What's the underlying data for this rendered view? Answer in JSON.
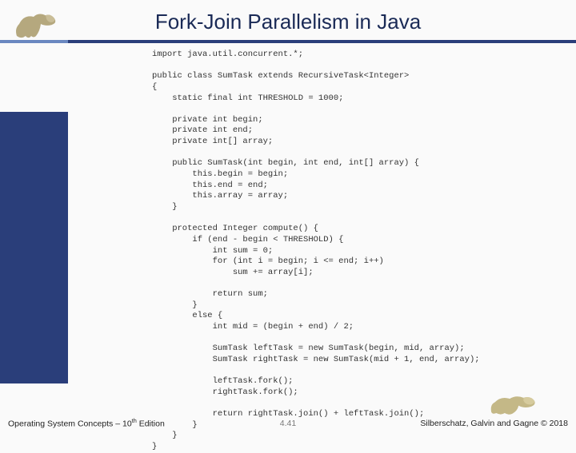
{
  "title": "Fork-Join Parallelism in Java",
  "code": "import java.util.concurrent.*;\n\npublic class SumTask extends RecursiveTask<Integer>\n{\n    static final int THRESHOLD = 1000;\n\n    private int begin;\n    private int end;\n    private int[] array;\n\n    public SumTask(int begin, int end, int[] array) {\n        this.begin = begin;\n        this.end = end;\n        this.array = array;\n    }\n\n    protected Integer compute() {\n        if (end - begin < THRESHOLD) {\n            int sum = 0;\n            for (int i = begin; i <= end; i++)\n                sum += array[i];\n\n            return sum;\n        }\n        else {\n            int mid = (begin + end) / 2;\n\n            SumTask leftTask = new SumTask(begin, mid, array);\n            SumTask rightTask = new SumTask(mid + 1, end, array);\n\n            leftTask.fork();\n            rightTask.fork();\n\n            return rightTask.join() + leftTask.join();\n        }\n    }\n}",
  "footer": {
    "left_a": "Operating System Concepts – 10",
    "left_b": " Edition",
    "center": "4.41",
    "right": "Silberschatz, Galvin and Gagne © 2018"
  }
}
